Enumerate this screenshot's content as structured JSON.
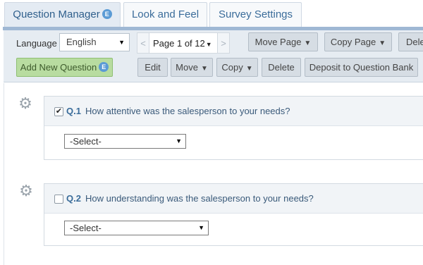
{
  "tabs": [
    {
      "label": "Question Manager",
      "badge": "E",
      "active": true
    },
    {
      "label": "Look and Feel"
    },
    {
      "label": "Survey Settings"
    }
  ],
  "toolbar": {
    "language_label": "Language",
    "language_value": "English",
    "pager": {
      "prev": "<",
      "page_label": "Page 1 of 12",
      "next": ">"
    },
    "move_page": "Move Page",
    "copy_page": "Copy Page",
    "delete_page": "Dele",
    "add_new_question": "Add New Question",
    "add_badge": "E",
    "edit": "Edit",
    "move": "Move",
    "copy": "Copy",
    "delete": "Delete",
    "deposit": "Deposit to Question Bank"
  },
  "questions": [
    {
      "number": "Q.1",
      "text": "How attentive was the salesperson to your needs?",
      "checked": true,
      "select_value": "-Select-"
    },
    {
      "number": "Q.2",
      "text": "How understanding was the salesperson to your needs?",
      "checked": false,
      "select_value": "-Select-"
    }
  ],
  "icons": {
    "settings": "gear-icon",
    "dropdown": "caret-down-icon",
    "check": "checkmark-icon"
  },
  "colors": {
    "accent": "#3a6c9a",
    "add_button": "#b8dca0",
    "badge": "#5b9bd5",
    "panel": "#e6ecf2"
  }
}
